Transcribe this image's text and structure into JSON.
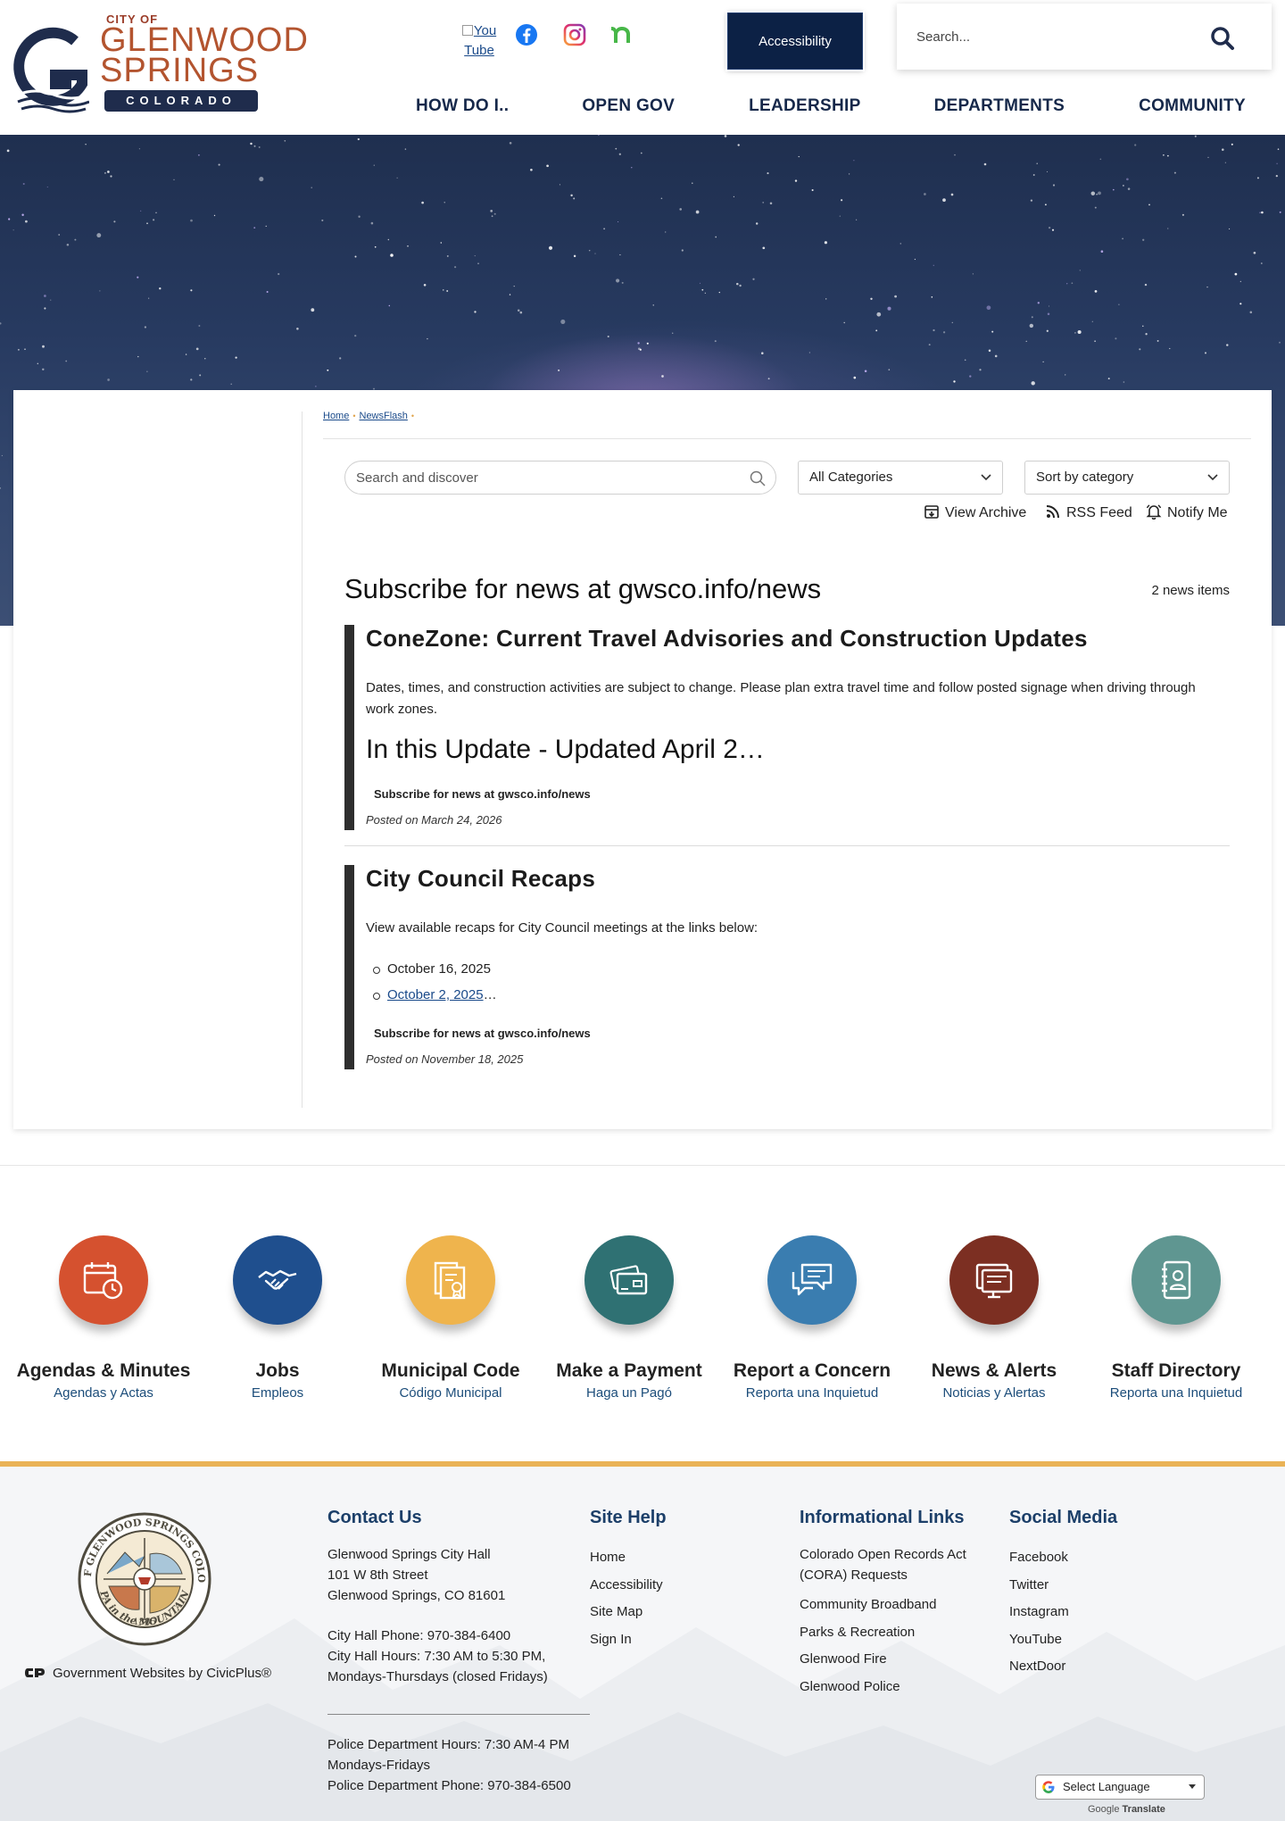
{
  "header": {
    "logo": {
      "city_of": "CITY OF",
      "line1": "GLENWOOD",
      "line2": "SPRINGS",
      "state": "COLORADO"
    },
    "socials": {
      "youtube_alt": "You Tube"
    },
    "accessibility_label": "Accessibility",
    "search_placeholder": "Search..."
  },
  "nav": {
    "items": [
      "HOW DO I..",
      "OPEN GOV",
      "LEADERSHIP",
      "DEPARTMENTS",
      "COMMUNITY"
    ]
  },
  "breadcrumb": {
    "home": "Home",
    "current": "NewsFlash"
  },
  "newsflash": {
    "search_placeholder": "Search and discover",
    "category_select": "All Categories",
    "sort_select": "Sort by category",
    "actions": {
      "archive": "View Archive",
      "rss": "RSS Feed",
      "notify": "Notify Me"
    },
    "title": "Subscribe for news at gwsco.info/news",
    "count": "2 news items",
    "items": [
      {
        "title": "ConeZone: Current Travel Advisories and Construction Updates",
        "text": "Dates, times, and construction activities are subject to change. Please plan extra travel time and follow posted signage when driving through work zones.",
        "subheading": "In this Update - Updated April 2…",
        "subscribe": "Subscribe for news at gwsco.info/news",
        "posted": "Posted on March 24, 2026"
      },
      {
        "title": "City Council Recaps",
        "text": "View available recaps for City Council meetings at the links below:",
        "list": [
          "October 16, 2025",
          "October 2, 2025"
        ],
        "list_suffix": "…",
        "subscribe": "Subscribe for news at gwsco.info/news",
        "posted": "Posted on November 18, 2025"
      }
    ]
  },
  "quick_links": [
    {
      "title": "Agendas & Minutes",
      "subtitle": "Agendas y Actas",
      "color": "#d5512f",
      "icon": "calendar-clock-icon"
    },
    {
      "title": "Jobs",
      "subtitle": "Empleos",
      "color": "#1f4f8e",
      "icon": "handshake-icon"
    },
    {
      "title": "Municipal Code",
      "subtitle": "Código Municipal",
      "color": "#efb44d",
      "icon": "code-document-icon"
    },
    {
      "title": "Make a Payment",
      "subtitle": "Haga un Pagó",
      "color": "#2f7173",
      "icon": "credit-card-icon"
    },
    {
      "title": "Report a Concern",
      "subtitle": "Reporta una Inquietud",
      "color": "#3a7db0",
      "icon": "chat-bubbles-icon"
    },
    {
      "title": "News & Alerts",
      "subtitle": "Noticias y Alertas",
      "color": "#7c2f22",
      "icon": "news-monitor-icon"
    },
    {
      "title": "Staff Directory",
      "subtitle": "Reporta una Inquietud",
      "color": "#5f9691",
      "icon": "address-book-icon"
    }
  ],
  "footer": {
    "seal_text": {
      "top": "CITY OF GLENWOOD SPRINGS COLORADO",
      "bottom": "SPA in the MOUNTAINS",
      "year": "1885"
    },
    "civicplus": "Government Websites by CivicPlus®",
    "contact": {
      "heading": "Contact Us",
      "lines1": [
        "Glenwood Springs City Hall",
        "101 W 8th Street",
        "Glenwood Springs, CO 81601"
      ],
      "lines2": [
        "City Hall Phone: 970-384-6400",
        "City Hall Hours: 7:30 AM to 5:30 PM,",
        "Mondays-Thursdays (closed Fridays)"
      ],
      "lines3": [
        "Police Department Hours: 7:30 AM-4 PM",
        "Mondays-Fridays",
        "Police Department Phone: 970-384-6500"
      ]
    },
    "site_help": {
      "heading": "Site Help",
      "links": [
        "Home",
        "Accessibility",
        "Site Map",
        "Sign In"
      ]
    },
    "info_links": {
      "heading": "Informational Links",
      "cora_line1": "Colorado Open Records Act",
      "cora_line2": "(CORA) Requests",
      "links": [
        "Community Broadband",
        "Parks & Recreation",
        "Glenwood Fire",
        "Glenwood Police"
      ]
    },
    "social": {
      "heading": "Social Media",
      "links": [
        "Facebook",
        "Twitter",
        "Instagram",
        "YouTube",
        "NextDoor"
      ]
    },
    "translate": {
      "label": "Select Language",
      "powered_prefix": "Google",
      "powered_word": "Translate"
    }
  }
}
